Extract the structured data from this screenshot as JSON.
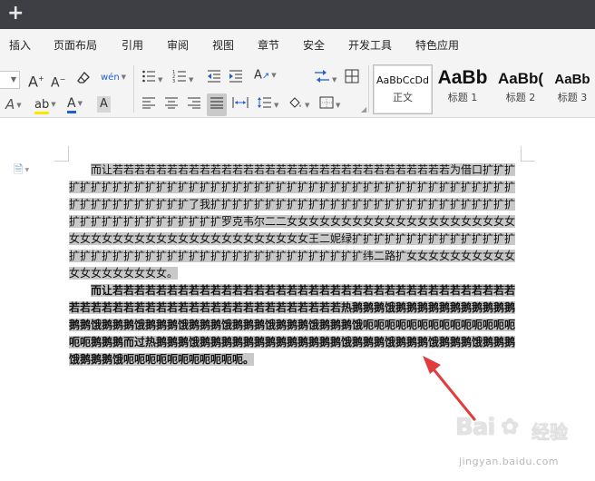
{
  "tabs": [
    "插入",
    "页面布局",
    "引用",
    "审阅",
    "视图",
    "章节",
    "安全",
    "开发工具",
    "特色应用"
  ],
  "ribbon": {
    "font_grow": "A",
    "font_shrink": "A",
    "phonetic": "wén",
    "text_effect": "A",
    "highlight": "ab",
    "font_color": "A",
    "char_shading": "A"
  },
  "styles": [
    {
      "preview": "AaBbCcDd",
      "name": "正文"
    },
    {
      "preview": "AaBb",
      "name": "标题 1"
    },
    {
      "preview": "AaBb(",
      "name": "标题 2"
    },
    {
      "preview": "AaBb",
      "name": "标题 3"
    }
  ],
  "document": {
    "paragraph1": "而让若若若若若若若若若若若若若若若若若若若若若若若若若若若若若若若为借口扩扩扩扩扩扩扩扩扩扩扩扩扩扩扩扩扩扩扩扩扩扩扩扩扩扩扩扩扩扩扩扩扩扩扩扩扩扩扩扩扩扩扩扩扩扩扩扩扩扩扩扩扩扩扩了我扩扩扩扩扩扩扩扩扩扩扩扩扩扩扩扩扩扩扩扩扩扩扩扩扩扩扩扩扩扩扩扩扩扩扩扩扩扩扩扩扩扩罗克韦尔二二女女女女女女女女女女女女女女女女女女女女女女女女女女女女女女女女女女女女女女女女女女女王二妮绿扩扩扩扩扩扩扩扩扩扩扩扩扩扩扩扩扩扩扩扩扩扩扩扩扩扩扩扩扩扩扩扩扩扩扩扩扩扩扩扩扩扩纬二路扩女女女女女女女女女女女女女女女女女女女。",
    "paragraph2": "而让若若若若若若若若若若若若若若若若若若若若若若若若若若若若若若若若若若若若若若若若若若若若若若若若若若若若若若若若若若若若若若热鹅鹅鹅饿鹅鹅鹅鹅鹅鹅鹅鹅鹅鹅鹅鹅鹅饿鹅鹅鹅饿鹅鹅鹅饿鹅鹅鹅饿鹅鹅鹅饿鹅鹅鹅饿鹅鹅鹅饿呃呃呃呃呃呃呃呃呃呃呃呃呃呃呃呃鹅鹅鹅而过热鹅鹅鹅饿鹅鹅鹅鹅鹅鹅鹅鹅鹅鹅鹅鹅鹅饿鹅鹅鹅饿鹅鹅鹅饿鹅鹅鹅饿鹅鹅鹅饿鹅鹅鹅饿呃呃呃呃呃呃呃呃呃呃呃。"
  },
  "watermark": {
    "logo": "Bai",
    "logo_tail": "经验",
    "url": "jingyan.baidu.com"
  },
  "colors": {
    "titlebar": "#3d3f45",
    "ribbon_bg": "#f4f4f4",
    "selection": "#c8c8c8",
    "arrow": "#e23b3b",
    "font_color_bar": "#1f5fd0",
    "highlight_bar": "#ffe600"
  }
}
